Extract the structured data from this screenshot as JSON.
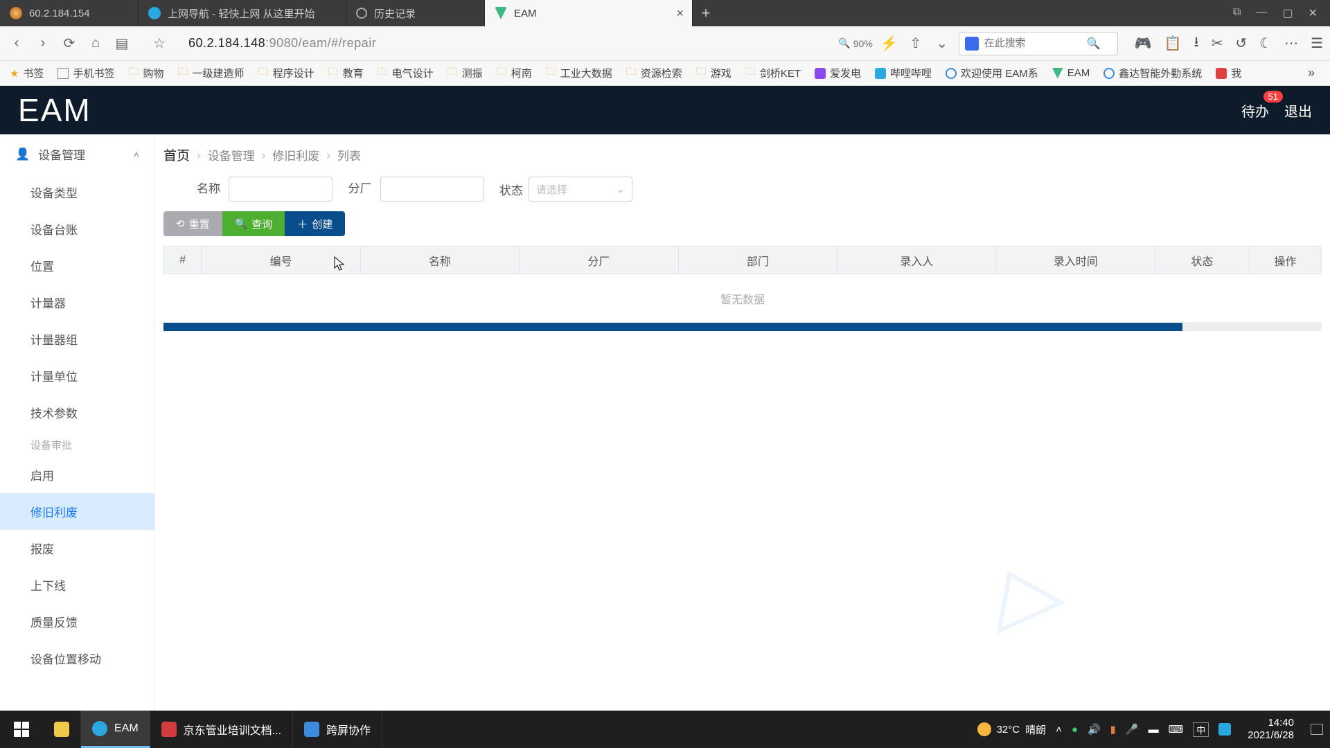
{
  "browser": {
    "tabs": [
      {
        "title": "60.2.184.154",
        "favicon": "#d77a2b"
      },
      {
        "title": "上网导航 - 轻快上网 从这里开始",
        "favicon": "#2aa8e0"
      },
      {
        "title": "历史记录",
        "favicon": "#888888"
      },
      {
        "title": "EAM",
        "favicon": "#41b883",
        "active": true
      }
    ],
    "address_host": "60.2.184.148",
    "address_path": ":9080/eam/#/repair",
    "zoom": "90%",
    "search_placeholder": "在此搜索",
    "bookmarks": [
      "书签",
      "手机书签",
      "购物",
      "一级建造师",
      "程序设计",
      "教育",
      "电气设计",
      "测振",
      "柯南",
      "工业大数据",
      "资源检索",
      "游戏",
      "剑桥KET",
      "爱发电",
      "哔哩哔哩",
      "欢迎使用 EAM系",
      "EAM",
      "鑫达智能外勤系统",
      "我"
    ]
  },
  "app": {
    "logo": "EAM",
    "pending_label": "待办",
    "pending_count": "51",
    "logout_label": "退出"
  },
  "sidebar": {
    "group": "设备管理",
    "items": [
      "设备类型",
      "设备台账",
      "位置",
      "计量器",
      "计量器组",
      "计量单位",
      "技术参数"
    ],
    "section_label": "设备审批",
    "items2": [
      "启用",
      "修旧利废",
      "报废",
      "上下线",
      "质量反馈",
      "设备位置移动"
    ],
    "active": "修旧利废"
  },
  "breadcrumb": {
    "root": "首页",
    "p1": "设备管理",
    "p2": "修旧利废",
    "p3": "列表"
  },
  "filters": {
    "name_label": "名称",
    "branch_label": "分厂",
    "status_label": "状态",
    "status_placeholder": "请选择"
  },
  "buttons": {
    "reset": "重置",
    "query": "查询",
    "create": "创建"
  },
  "table": {
    "columns": [
      "#",
      "编号",
      "名称",
      "分厂",
      "部门",
      "录入人",
      "录入时间",
      "状态",
      "操作"
    ],
    "empty": "暂无数据"
  },
  "taskbar": {
    "apps": [
      {
        "label": "",
        "color": "#f0c94a"
      },
      {
        "label": "EAM",
        "color": "#2aa8e0",
        "active": true
      },
      {
        "label": "京东管业培训文档...",
        "color": "#d23c3c"
      },
      {
        "label": "跨屏协作",
        "color": "#3a8be0"
      }
    ],
    "weather_temp": "32°C",
    "weather_text": "晴朗",
    "ime": "中",
    "time": "14:40",
    "date": "2021/6/28"
  }
}
